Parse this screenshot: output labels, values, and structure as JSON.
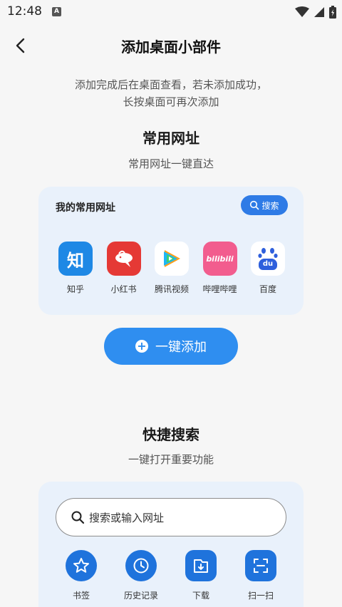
{
  "status_bar": {
    "time": "12:48",
    "notification_badge": "A"
  },
  "header": {
    "title": "添加桌面小部件",
    "back_icon": "chevron-left-icon"
  },
  "intro": {
    "line1": "添加完成后在桌面查看，若未添加成功，",
    "line2": "长按桌面可再次添加"
  },
  "section1": {
    "title": "常用网址",
    "subtitle": "常用网址一键直达",
    "card_title": "我的常用网址",
    "search_button": "搜索",
    "apps": [
      {
        "label": "知乎",
        "icon_text": "知",
        "color": "#1e88e5"
      },
      {
        "label": "小红书",
        "icon_text": "",
        "color": "#e53935"
      },
      {
        "label": "腾讯视频",
        "icon_text": "",
        "color": "#ffffff"
      },
      {
        "label": "哔哩哔哩",
        "icon_text": "bilibili",
        "color": "#f25d8e"
      },
      {
        "label": "百度",
        "icon_text": "du",
        "color": "#ffffff"
      }
    ]
  },
  "add_button": {
    "label": "一键添加",
    "plus": "+"
  },
  "section2": {
    "title": "快捷搜索",
    "subtitle": "一键打开重要功能",
    "search_placeholder": "搜索或输入网址",
    "tools": [
      {
        "label": "书签",
        "icon": "star-icon"
      },
      {
        "label": "历史记录",
        "icon": "clock-icon"
      },
      {
        "label": "下载",
        "icon": "download-icon"
      },
      {
        "label": "扫一扫",
        "icon": "scan-icon"
      }
    ]
  },
  "colors": {
    "accent": "#2f8ef0",
    "card_bg": "#e9f1fb",
    "tool_blue": "#1f73dc"
  }
}
